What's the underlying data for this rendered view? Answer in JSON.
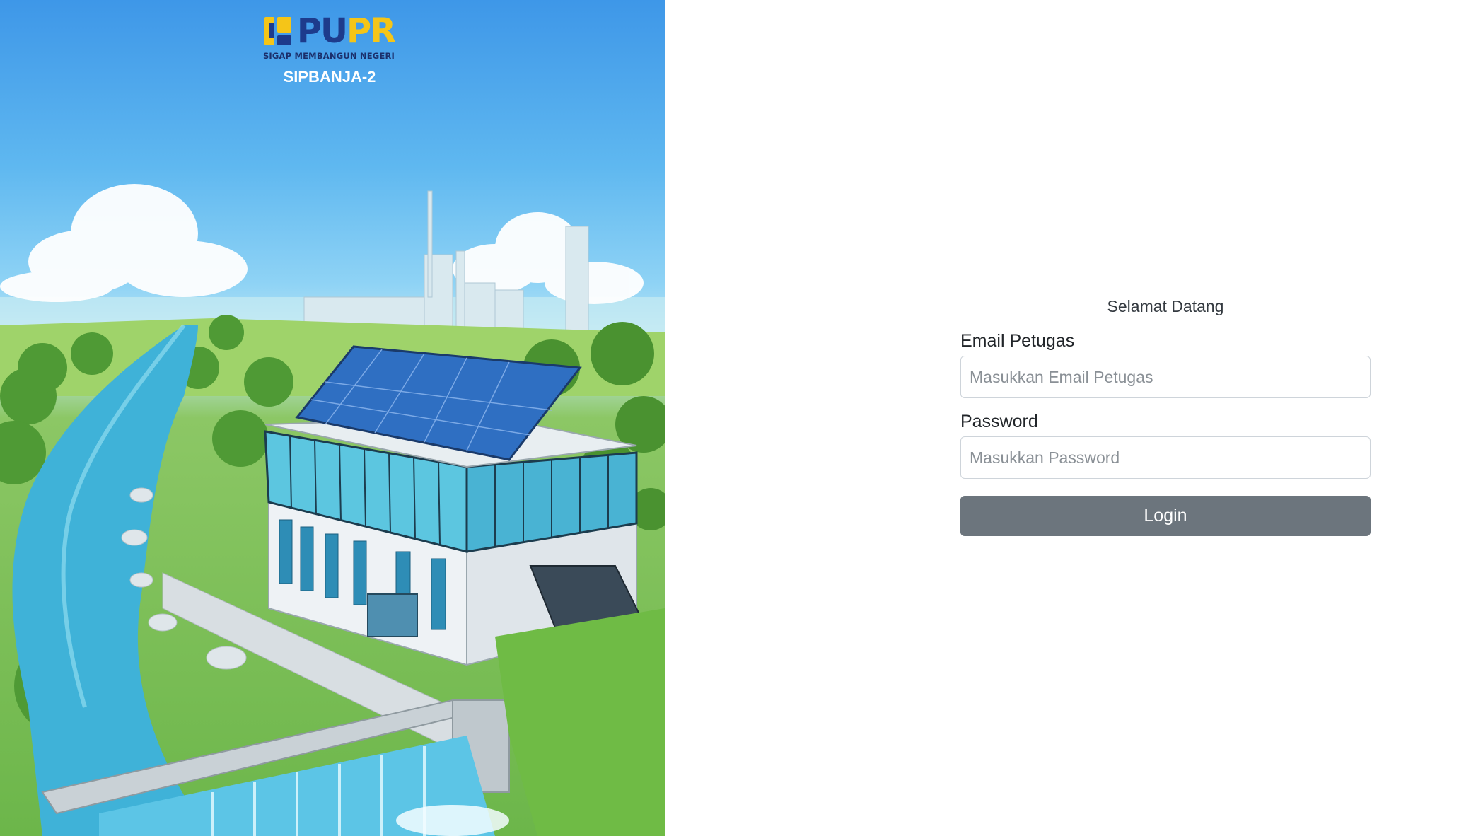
{
  "brand": {
    "logo_text_left": "PU",
    "logo_text_right": "PR",
    "tagline": "SIGAP MEMBANGUN NEGERI",
    "app_name": "SIPBANJA-2"
  },
  "login": {
    "welcome": "Selamat Datang",
    "email_label": "Email Petugas",
    "email_placeholder": "Masukkan Email Petugas",
    "email_value": "",
    "password_label": "Password",
    "password_placeholder": "Masukkan Password",
    "password_value": "",
    "submit_label": "Login"
  },
  "colors": {
    "brand_blue": "#1d3b8c",
    "brand_yellow": "#f5c518",
    "button_gray": "#6c757d"
  },
  "hero": {
    "illustration": "water-pumping-station-with-solar-panels-beside-river"
  }
}
